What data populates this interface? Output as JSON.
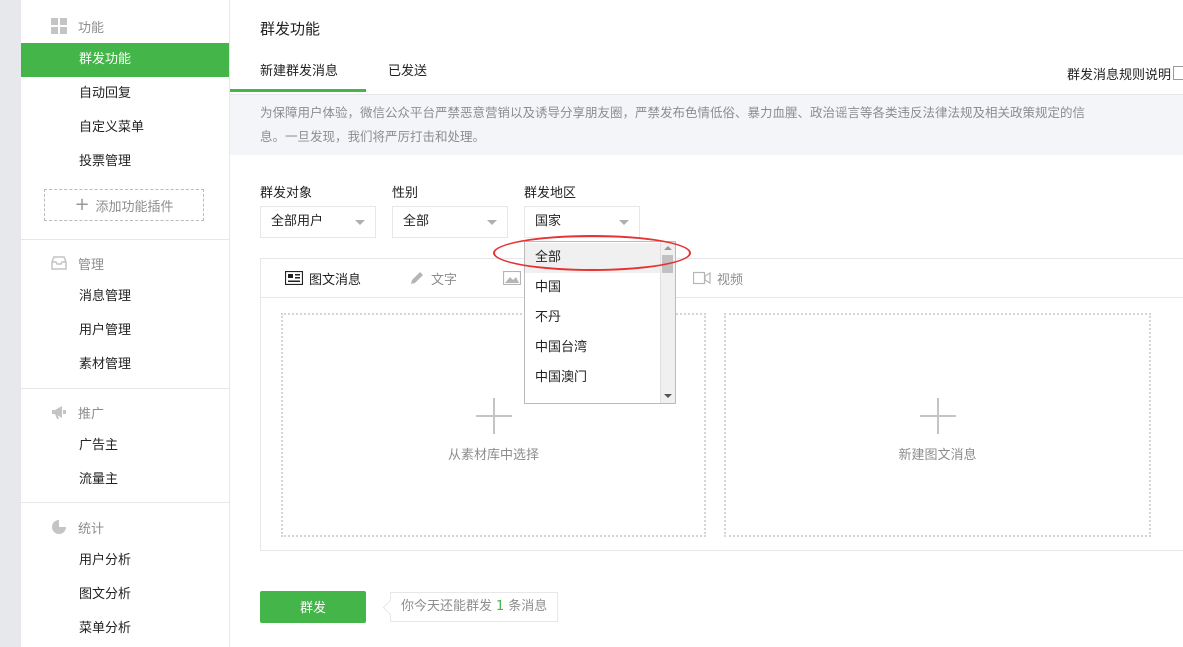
{
  "sidebar": {
    "sections": [
      {
        "title": "功能",
        "icon": "grid-icon"
      },
      {
        "title": "管理",
        "icon": "inbox-icon"
      },
      {
        "title": "推广",
        "icon": "megaphone-icon"
      },
      {
        "title": "统计",
        "icon": "pie-chart-icon"
      }
    ],
    "function_items": [
      "群发功能",
      "自动回复",
      "自定义菜单",
      "投票管理"
    ],
    "add_plugin": "添加功能插件",
    "manage_items": [
      "消息管理",
      "用户管理",
      "素材管理"
    ],
    "promo_items": [
      "广告主",
      "流量主"
    ],
    "stats_items": [
      "用户分析",
      "图文分析",
      "菜单分析"
    ]
  },
  "main": {
    "title": "群发功能",
    "tabs": [
      "新建群发消息",
      "已发送"
    ],
    "rules_link": "群发消息规则说明",
    "notice_line1": "为保障用户体验，微信公众平台严禁恶意营销以及诱导分享朋友圈，严禁发布色情低俗、暴力血腥、政治谣言等各类违反法律法规及相关政策规定的信",
    "notice_line2": "息。一旦发现，我们将严厉打击和处理。",
    "filters": {
      "target_label": "群发对象",
      "target_value": "全部用户",
      "gender_label": "性别",
      "gender_value": "全部",
      "region_label": "群发地区",
      "region_value": "国家"
    },
    "region_options": [
      "全部",
      "中国",
      "不丹",
      "中国台湾",
      "中国澳门"
    ],
    "editor_tabs": [
      "图文消息",
      "文字",
      "视频"
    ],
    "card_library": "从素材库中选择",
    "card_new": "新建图文消息",
    "send_button": "群发",
    "tip_prefix": "你今天还能群发",
    "tip_count": "1",
    "tip_suffix": "条消息"
  },
  "colors": {
    "accent": "#44b549",
    "annotation": "#e53333"
  }
}
